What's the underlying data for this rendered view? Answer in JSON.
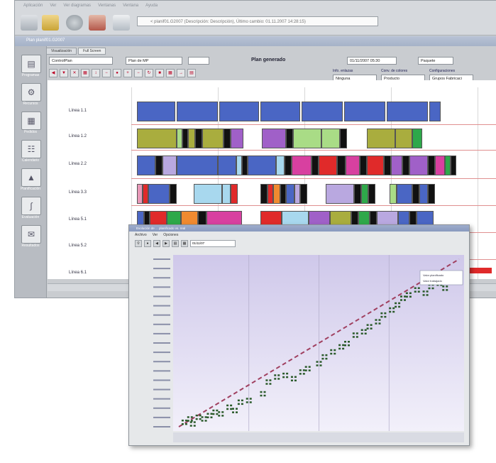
{
  "app": {
    "menu": [
      "Aplicación",
      "Ver",
      "Ver diagramas",
      "Ventanas",
      "Ventana",
      "Ayuda"
    ],
    "path_text": "< planif01.G2007 (Descripción: Descripción), Último cambio: 01.11.2007 14:28:15)",
    "window_title": "Plan planif01.G2007"
  },
  "sidebar": {
    "items": [
      {
        "label": "Programas",
        "icon": "program-icon"
      },
      {
        "label": "Recursos",
        "icon": "resource-icon"
      },
      {
        "label": "Pedidos",
        "icon": "orders-icon"
      },
      {
        "label": "Calendario",
        "icon": "calendar-icon"
      },
      {
        "label": "Planificación",
        "icon": "planning-icon"
      },
      {
        "label": "Evaluación",
        "icon": "evaluation-icon"
      },
      {
        "label": "Resultados",
        "icon": "results-icon"
      }
    ]
  },
  "tabs": [
    "Visualización",
    "Full Screen"
  ],
  "controls": {
    "selects": [
      "ControlPlan",
      "Plan de MP",
      "",
      "Paquete"
    ],
    "date_value": "01/11/2007 05:30",
    "status": "Plan generado",
    "group_titles": [
      "Info. enlazas",
      "Conv. de colores",
      "Configuraciones"
    ],
    "group_values": [
      "Ninguna",
      "Producto",
      "Grupos Fabricaci"
    ]
  },
  "gantt": {
    "rows": [
      "Línea 1.1",
      "Línea 1.2",
      "Línea 2.2",
      "Línea 3.3",
      "Línea 5.1",
      "Línea 5.2",
      "Línea 6.1"
    ],
    "bar_colors": {
      "blue": "#4a66c4",
      "olive": "#a9ad3e",
      "green": "#2ea84a",
      "light_green": "#a9dc86",
      "purple": "#a060c8",
      "magenta": "#d840a0",
      "red": "#e02a2a",
      "black": "#111111",
      "light_blue": "#a8d8ee",
      "orange": "#f08a30",
      "lavender": "#b9a8e0",
      "pink": "#e898b8"
    }
  },
  "chart_window": {
    "title": "Evolución de ... planificado vs. real",
    "menu": [
      "Archivo",
      "Ver",
      "Opciones"
    ],
    "field": "01/11/07",
    "legend": [
      "Valor planificado",
      "Valor trabajado"
    ]
  },
  "chart_data": {
    "type": "scatter",
    "title": "",
    "xlabel": "",
    "ylabel": "",
    "xlim": [
      0,
      1
    ],
    "ylim": [
      0,
      1
    ],
    "grid": true,
    "legend_position": "top-right",
    "series": [
      {
        "name": "Valor planificado",
        "style": "dashed-line",
        "color": "#a04060",
        "points": [
          [
            0.0,
            0.0
          ],
          [
            1.0,
            1.0
          ]
        ]
      },
      {
        "name": "Valor trabajado",
        "style": "points",
        "color": "#2a5a2a",
        "points": [
          [
            0.02,
            0.03
          ],
          [
            0.04,
            0.05
          ],
          [
            0.05,
            0.02
          ],
          [
            0.07,
            0.06
          ],
          [
            0.09,
            0.05
          ],
          [
            0.11,
            0.07
          ],
          [
            0.13,
            0.09
          ],
          [
            0.15,
            0.08
          ],
          [
            0.18,
            0.12
          ],
          [
            0.2,
            0.1
          ],
          [
            0.22,
            0.15
          ],
          [
            0.25,
            0.16
          ],
          [
            0.3,
            0.2
          ],
          [
            0.32,
            0.27
          ],
          [
            0.35,
            0.3
          ],
          [
            0.38,
            0.31
          ],
          [
            0.41,
            0.29
          ],
          [
            0.44,
            0.33
          ],
          [
            0.46,
            0.35
          ],
          [
            0.5,
            0.38
          ],
          [
            0.52,
            0.42
          ],
          [
            0.55,
            0.45
          ],
          [
            0.58,
            0.48
          ],
          [
            0.6,
            0.5
          ],
          [
            0.63,
            0.55
          ],
          [
            0.66,
            0.57
          ],
          [
            0.68,
            0.6
          ],
          [
            0.71,
            0.63
          ],
          [
            0.73,
            0.67
          ],
          [
            0.76,
            0.7
          ],
          [
            0.78,
            0.73
          ],
          [
            0.8,
            0.77
          ],
          [
            0.82,
            0.79
          ],
          [
            0.85,
            0.82
          ],
          [
            0.88,
            0.8
          ],
          [
            0.9,
            0.84
          ],
          [
            0.93,
            0.86
          ],
          [
            0.95,
            0.83
          ]
        ]
      }
    ]
  }
}
